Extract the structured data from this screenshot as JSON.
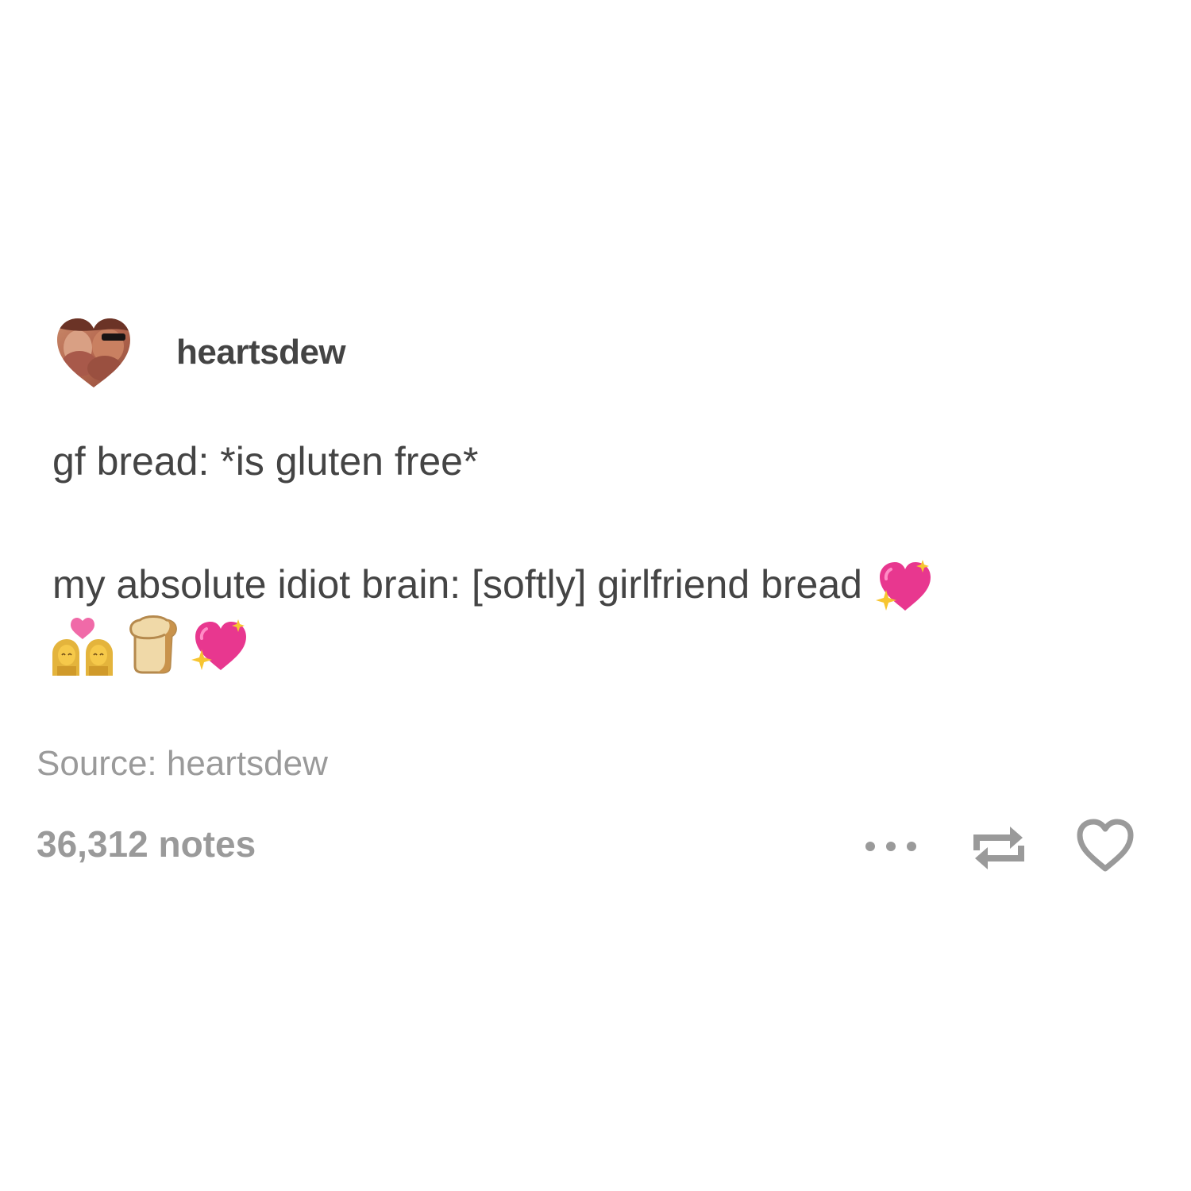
{
  "post": {
    "username": "heartsdew",
    "line1": "gf bread: *is gluten free*",
    "line2": "my absolute idiot brain: [softly] girlfriend bread",
    "emojis": [
      "sparkling-heart",
      "two-women-with-heart",
      "bread",
      "sparkling-heart"
    ],
    "source_label": "Source: heartsdew",
    "notes": "36,312 notes"
  },
  "actions": {
    "icons": [
      "more-icon",
      "reblog-icon",
      "heart-icon"
    ]
  },
  "colors": {
    "text": "#444444",
    "muted": "#9a9a9a",
    "heart_pink": "#e8378f",
    "sparkle_gold": "#f7c531"
  }
}
